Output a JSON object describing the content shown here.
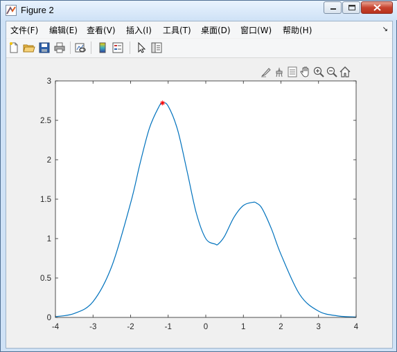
{
  "window": {
    "title": "Figure 2",
    "icon": "matlab-figure-icon",
    "controls": [
      "minimize-icon",
      "maximize-icon",
      "close-icon"
    ]
  },
  "menu": {
    "items": [
      {
        "label": "文件(F)"
      },
      {
        "label": "编辑(E)"
      },
      {
        "label": "查看(V)"
      },
      {
        "label": "插入(I)"
      },
      {
        "label": "工具(T)"
      },
      {
        "label": "桌面(D)"
      },
      {
        "label": "窗口(W)"
      },
      {
        "label": "帮助(H)"
      }
    ],
    "overflow_icon": "dock-arrow-icon"
  },
  "toolbar": {
    "icons": [
      "new-figure-icon",
      "open-file-icon",
      "save-icon",
      "print-icon",
      "link-plot-icon",
      "insert-colorbar-icon",
      "insert-legend-icon",
      "select-pointer-icon",
      "property-inspector-icon"
    ]
  },
  "axes_toolbar": {
    "icons": [
      "brush-data-icon",
      "data-cursor-icon",
      "restore-view-icon",
      "pan-icon",
      "zoom-in-icon",
      "zoom-out-icon",
      "home-icon"
    ]
  },
  "chart_data": {
    "type": "line",
    "title": "",
    "xlabel": "",
    "ylabel": "",
    "xlim": [
      -4,
      4
    ],
    "ylim": [
      0,
      3
    ],
    "xticks": [
      "-4",
      "-3",
      "-2",
      "-1",
      "0",
      "1",
      "2",
      "3",
      "4"
    ],
    "yticks": [
      "0",
      "0.5",
      "1",
      "1.5",
      "2",
      "2.5",
      "3"
    ],
    "grid": false,
    "series": [
      {
        "color": "#0072bd",
        "x": [
          -4,
          -3.5,
          -3,
          -2.5,
          -2,
          -1.75,
          -1.5,
          -1.25,
          -1.15,
          -1,
          -0.75,
          -0.5,
          -0.25,
          0,
          0.25,
          0.33,
          0.5,
          0.75,
          1,
          1.25,
          1.35,
          1.5,
          1.75,
          2,
          2.5,
          3,
          3.5,
          4
        ],
        "y": [
          0.01,
          0.05,
          0.2,
          0.65,
          1.45,
          1.95,
          2.4,
          2.67,
          2.72,
          2.68,
          2.38,
          1.86,
          1.32,
          1.0,
          0.93,
          0.93,
          1.03,
          1.27,
          1.42,
          1.46,
          1.45,
          1.38,
          1.12,
          0.8,
          0.29,
          0.08,
          0.02,
          0.005
        ]
      }
    ],
    "markers": [
      {
        "x": -1.15,
        "y": 2.72,
        "symbol": "*",
        "color": "#ff0000"
      }
    ]
  }
}
